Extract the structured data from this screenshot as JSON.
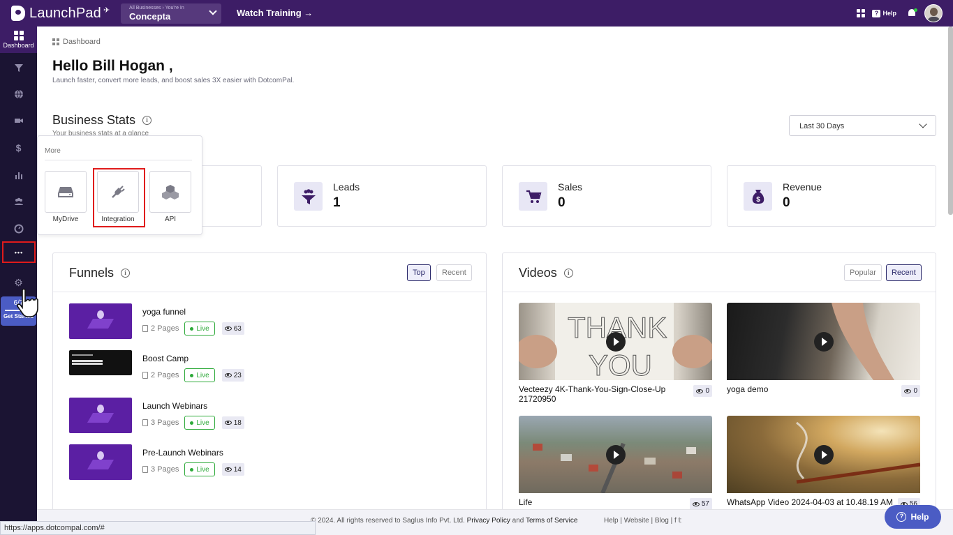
{
  "app": {
    "name": "LaunchPad"
  },
  "topbar": {
    "business_small": "All Businesses › You're In",
    "business_name": "Concepta",
    "watch_training": "Watch Training →",
    "help_label": "Help"
  },
  "sidebar": {
    "dashboard_label": "Dashboard",
    "more_dots": "•••",
    "get_started_count": "6/7",
    "get_started_label": "Get Started"
  },
  "breadcrumb": {
    "label": "Dashboard"
  },
  "greeting": {
    "title": "Hello Bill Hogan ,",
    "subtitle": "Launch faster, convert more leads, and boost sales 3X easier with DotcomPal."
  },
  "business_stats": {
    "title": "Business Stats",
    "subtitle": "Your business stats at a glance",
    "range": "Last 30 Days",
    "cards": [
      {
        "label": "Leads",
        "value": "1"
      },
      {
        "label": "Sales",
        "value": "0"
      },
      {
        "label": "Revenue",
        "value": "0"
      }
    ]
  },
  "more_popup": {
    "title": "More",
    "tiles": [
      {
        "label": "MyDrive"
      },
      {
        "label": "Integration"
      },
      {
        "label": "API"
      }
    ]
  },
  "funnels": {
    "title": "Funnels",
    "tab_top": "Top",
    "tab_recent": "Recent",
    "live_label": "Live",
    "items": [
      {
        "name": "yoga funnel",
        "pages": "2 Pages",
        "views": "63"
      },
      {
        "name": "Boost Camp",
        "pages": "2 Pages",
        "views": "23"
      },
      {
        "name": "Launch Webinars",
        "pages": "3 Pages",
        "views": "18"
      },
      {
        "name": "Pre-Launch Webinars",
        "pages": "3 Pages",
        "views": "14"
      }
    ]
  },
  "videos": {
    "title": "Videos",
    "tab_popular": "Popular",
    "tab_recent": "Recent",
    "items": [
      {
        "title": "Vecteezy 4K-Thank-You-Sign-Close-Up 21720950",
        "views": "0"
      },
      {
        "title": "yoga demo",
        "views": "0"
      },
      {
        "title": "Life",
        "views": "57"
      },
      {
        "title": "WhatsApp Video 2024-04-03 at 10.48.19 AM",
        "views": "56"
      }
    ]
  },
  "footer": {
    "copyright": "© 2024. All rights reserved to Saglus Info Pvt. Ltd.",
    "privacy": "Privacy Policy",
    "and": "and",
    "terms": "Terms of Service",
    "links": "Help  |  Website  |  Blog  |  f  𝕥"
  },
  "help_button": "Help",
  "status_url": "https://apps.dotcompal.com/#"
}
